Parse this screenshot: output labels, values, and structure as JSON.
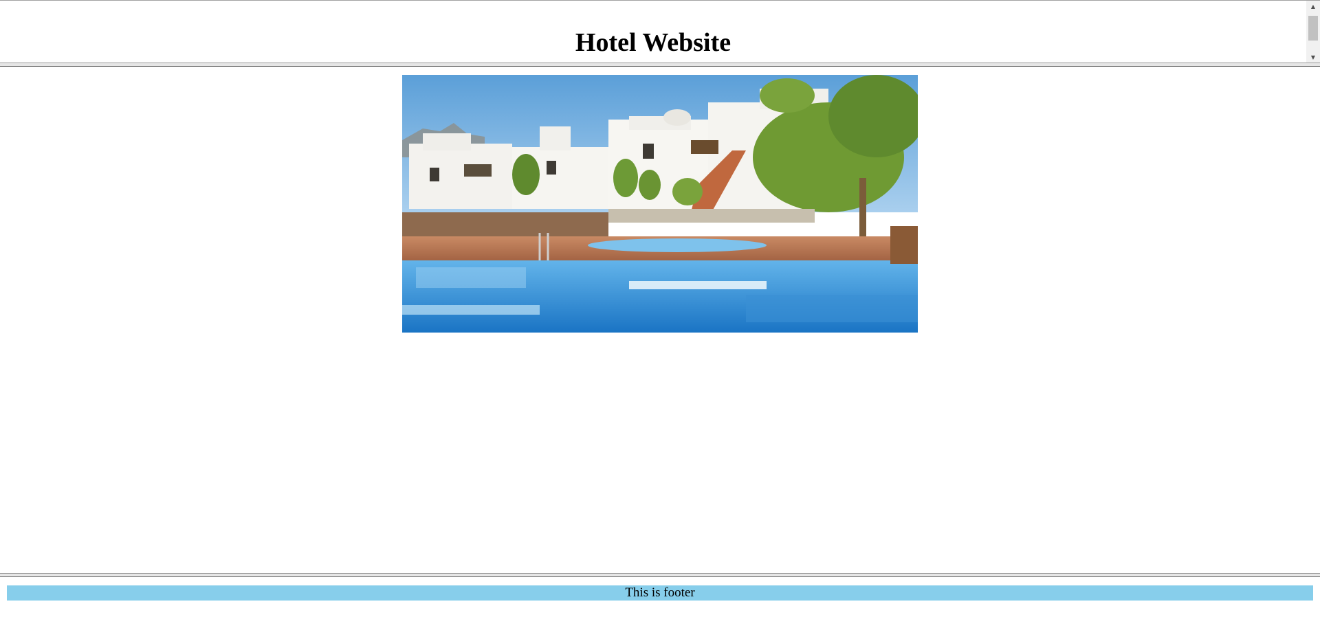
{
  "header": {
    "title": "Hotel Website"
  },
  "main": {
    "hero_image": {
      "icon": "hotel-pool-photo",
      "description_colors": {
        "sky": "#6aa9dc",
        "building": "#f4f4f2",
        "pool": "#2f8fd8",
        "deck": "#b5734f",
        "palm": "#5f8a2e"
      }
    }
  },
  "footer": {
    "text": "This is footer",
    "background": "#87ceeb"
  }
}
